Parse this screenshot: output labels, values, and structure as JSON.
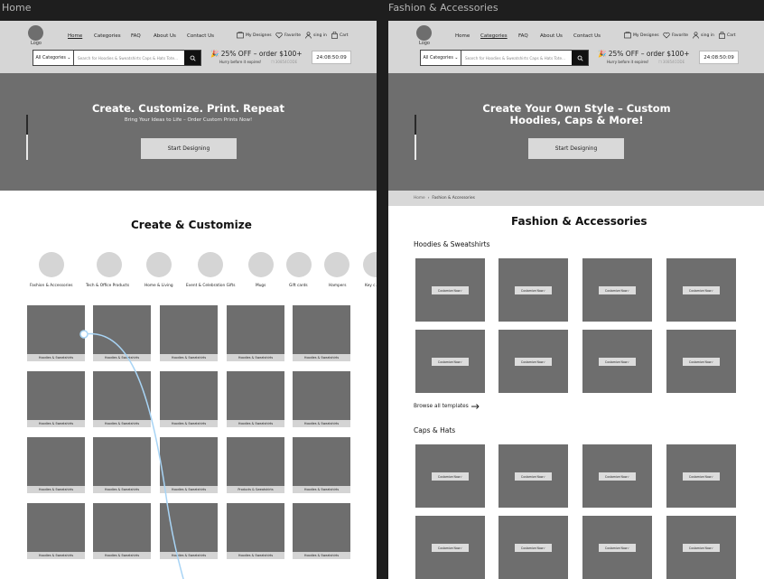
{
  "frames": {
    "home": {
      "label": "Home"
    },
    "fashion": {
      "label": "Fashion & Accessories"
    }
  },
  "header": {
    "logo": "Logo",
    "nav": [
      "Home",
      "Categories",
      "FAQ",
      "About Us",
      "Contact Us"
    ],
    "utils": {
      "designs": "My Designes",
      "favorite": "Favorite",
      "signin": "sing in",
      "cart": "Cart"
    },
    "search": {
      "category": "All Categories",
      "placeholder": "Search for Hoodies & Sweatshirts Caps & Hats Tote..."
    },
    "promo": {
      "headline": "25% OFF – order $100+",
      "sub": "Hurry before it expires!",
      "code": "30854CODE"
    },
    "timer": "24:08:50:09"
  },
  "home": {
    "hero_title": "Create. Customize. Print. Repeat",
    "hero_sub": "Bring Your Ideas to Life – Order Custom Prints Now!",
    "hero_button": "Start Designing",
    "section_title": "Create & Customize",
    "categories": [
      "Fashion & Accessories",
      "Tech & Office Products",
      "Home & Living",
      "Event & Celebration Gifts",
      "Mugs",
      "Gift cards",
      "Hampers",
      "Key c..."
    ],
    "tile_labels": [
      "Hoodies & Sweatshirts",
      "Hoodies & Sweatshirts",
      "Hoodies & Sweatshirts",
      "Hoodies & Sweatshirts",
      "Hoodies & Sweatshirts",
      "Hoodies & Sweatshirts",
      "Hoodies & Sweatshirts",
      "Hoodies & Sweatshirts",
      "Hoodies & Sweatshirts",
      "Hoodies & Sweatshirts",
      "Hoodies & Sweatshirts",
      "Hoodies & Sweatshirts",
      "Hoodies & Sweatshirts",
      "Products & Sweatshirts",
      "Hoodies & Sweatshirts",
      "Hoodies & Sweatshirts",
      "Hoodies & Sweatshirts",
      "Hoodies & Sweatshirts",
      "Hoodies & Sweatshirts",
      "Hoodies & Sweatshirts"
    ]
  },
  "fashion": {
    "hero_title_line1": "Create Your Own Style – Custom",
    "hero_title_line2": "Hoodies, Caps & More!",
    "hero_button": "Start Designing",
    "breadcrumb_home": "Home",
    "breadcrumb_current": "Fashion & Accessories",
    "page_title": "Fashion & Accessories",
    "section1": "Hoodies & Sweatshirts",
    "section2": "Caps & Hats",
    "card_button": "Customize Now",
    "browse_all": "Browse all templates"
  },
  "colors": {
    "canvas": "#1e1e1e",
    "header": "#d6d6d6",
    "hero": "#6e6e6e",
    "placeholder": "#6e6e6e",
    "connector": "#a8d4f5"
  }
}
